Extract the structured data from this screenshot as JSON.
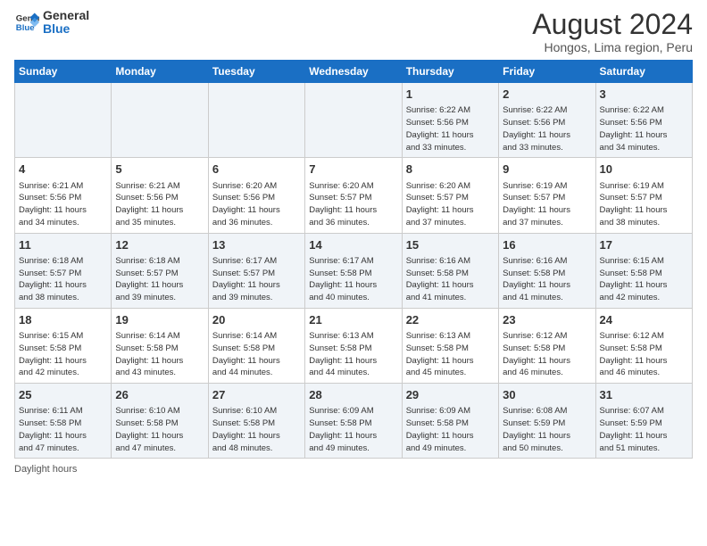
{
  "logo": {
    "line1": "General",
    "line2": "Blue"
  },
  "title": "August 2024",
  "subtitle": "Hongos, Lima region, Peru",
  "days_of_week": [
    "Sunday",
    "Monday",
    "Tuesday",
    "Wednesday",
    "Thursday",
    "Friday",
    "Saturday"
  ],
  "weeks": [
    [
      {
        "day": "",
        "info": ""
      },
      {
        "day": "",
        "info": ""
      },
      {
        "day": "",
        "info": ""
      },
      {
        "day": "",
        "info": ""
      },
      {
        "day": "1",
        "info": "Sunrise: 6:22 AM\nSunset: 5:56 PM\nDaylight: 11 hours\nand 33 minutes."
      },
      {
        "day": "2",
        "info": "Sunrise: 6:22 AM\nSunset: 5:56 PM\nDaylight: 11 hours\nand 33 minutes."
      },
      {
        "day": "3",
        "info": "Sunrise: 6:22 AM\nSunset: 5:56 PM\nDaylight: 11 hours\nand 34 minutes."
      }
    ],
    [
      {
        "day": "4",
        "info": "Sunrise: 6:21 AM\nSunset: 5:56 PM\nDaylight: 11 hours\nand 34 minutes."
      },
      {
        "day": "5",
        "info": "Sunrise: 6:21 AM\nSunset: 5:56 PM\nDaylight: 11 hours\nand 35 minutes."
      },
      {
        "day": "6",
        "info": "Sunrise: 6:20 AM\nSunset: 5:56 PM\nDaylight: 11 hours\nand 36 minutes."
      },
      {
        "day": "7",
        "info": "Sunrise: 6:20 AM\nSunset: 5:57 PM\nDaylight: 11 hours\nand 36 minutes."
      },
      {
        "day": "8",
        "info": "Sunrise: 6:20 AM\nSunset: 5:57 PM\nDaylight: 11 hours\nand 37 minutes."
      },
      {
        "day": "9",
        "info": "Sunrise: 6:19 AM\nSunset: 5:57 PM\nDaylight: 11 hours\nand 37 minutes."
      },
      {
        "day": "10",
        "info": "Sunrise: 6:19 AM\nSunset: 5:57 PM\nDaylight: 11 hours\nand 38 minutes."
      }
    ],
    [
      {
        "day": "11",
        "info": "Sunrise: 6:18 AM\nSunset: 5:57 PM\nDaylight: 11 hours\nand 38 minutes."
      },
      {
        "day": "12",
        "info": "Sunrise: 6:18 AM\nSunset: 5:57 PM\nDaylight: 11 hours\nand 39 minutes."
      },
      {
        "day": "13",
        "info": "Sunrise: 6:17 AM\nSunset: 5:57 PM\nDaylight: 11 hours\nand 39 minutes."
      },
      {
        "day": "14",
        "info": "Sunrise: 6:17 AM\nSunset: 5:58 PM\nDaylight: 11 hours\nand 40 minutes."
      },
      {
        "day": "15",
        "info": "Sunrise: 6:16 AM\nSunset: 5:58 PM\nDaylight: 11 hours\nand 41 minutes."
      },
      {
        "day": "16",
        "info": "Sunrise: 6:16 AM\nSunset: 5:58 PM\nDaylight: 11 hours\nand 41 minutes."
      },
      {
        "day": "17",
        "info": "Sunrise: 6:15 AM\nSunset: 5:58 PM\nDaylight: 11 hours\nand 42 minutes."
      }
    ],
    [
      {
        "day": "18",
        "info": "Sunrise: 6:15 AM\nSunset: 5:58 PM\nDaylight: 11 hours\nand 42 minutes."
      },
      {
        "day": "19",
        "info": "Sunrise: 6:14 AM\nSunset: 5:58 PM\nDaylight: 11 hours\nand 43 minutes."
      },
      {
        "day": "20",
        "info": "Sunrise: 6:14 AM\nSunset: 5:58 PM\nDaylight: 11 hours\nand 44 minutes."
      },
      {
        "day": "21",
        "info": "Sunrise: 6:13 AM\nSunset: 5:58 PM\nDaylight: 11 hours\nand 44 minutes."
      },
      {
        "day": "22",
        "info": "Sunrise: 6:13 AM\nSunset: 5:58 PM\nDaylight: 11 hours\nand 45 minutes."
      },
      {
        "day": "23",
        "info": "Sunrise: 6:12 AM\nSunset: 5:58 PM\nDaylight: 11 hours\nand 46 minutes."
      },
      {
        "day": "24",
        "info": "Sunrise: 6:12 AM\nSunset: 5:58 PM\nDaylight: 11 hours\nand 46 minutes."
      }
    ],
    [
      {
        "day": "25",
        "info": "Sunrise: 6:11 AM\nSunset: 5:58 PM\nDaylight: 11 hours\nand 47 minutes."
      },
      {
        "day": "26",
        "info": "Sunrise: 6:10 AM\nSunset: 5:58 PM\nDaylight: 11 hours\nand 47 minutes."
      },
      {
        "day": "27",
        "info": "Sunrise: 6:10 AM\nSunset: 5:58 PM\nDaylight: 11 hours\nand 48 minutes."
      },
      {
        "day": "28",
        "info": "Sunrise: 6:09 AM\nSunset: 5:58 PM\nDaylight: 11 hours\nand 49 minutes."
      },
      {
        "day": "29",
        "info": "Sunrise: 6:09 AM\nSunset: 5:58 PM\nDaylight: 11 hours\nand 49 minutes."
      },
      {
        "day": "30",
        "info": "Sunrise: 6:08 AM\nSunset: 5:59 PM\nDaylight: 11 hours\nand 50 minutes."
      },
      {
        "day": "31",
        "info": "Sunrise: 6:07 AM\nSunset: 5:59 PM\nDaylight: 11 hours\nand 51 minutes."
      }
    ]
  ],
  "legend": {
    "label": "Daylight hours"
  }
}
